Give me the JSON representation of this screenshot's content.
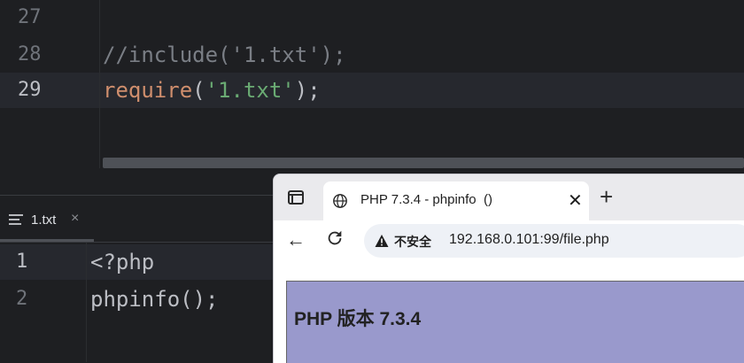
{
  "top_editor": {
    "lines": [
      {
        "number": "27",
        "code": ""
      },
      {
        "number": "28",
        "code": "//include('1.txt');"
      },
      {
        "number": "29",
        "parts": [
          "require",
          "(",
          "'1.txt'",
          ");"
        ]
      }
    ]
  },
  "bottom_editor": {
    "tab": {
      "label": "1.txt",
      "close": "×",
      "icon": "text-file-icon"
    },
    "lines": [
      {
        "number": "1",
        "code": "<?php"
      },
      {
        "number": "2",
        "code": "phpinfo();"
      }
    ]
  },
  "browser": {
    "tab_title": "PHP 7.3.4 - phpinfo  ()",
    "tab_close": "✕",
    "new_tab": "+",
    "security_label": "不安全",
    "url": "192.168.0.101:99/file.php",
    "page_heading": "PHP 版本 7.3.4"
  },
  "colors": {
    "editor_bg": "#1e1f22",
    "keyword": "#cf8e6d",
    "string": "#6aab73",
    "php_header": "#9999cc"
  }
}
